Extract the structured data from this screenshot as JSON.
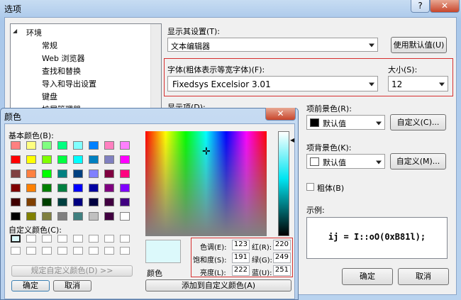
{
  "window": {
    "title": "选项",
    "help": "?",
    "close": "✕"
  },
  "tree": {
    "root": "环境",
    "expander": "◢",
    "items": [
      "常规",
      "Web 浏览器",
      "查找和替换",
      "导入和导出设置",
      "键盘",
      "扩展管理器"
    ]
  },
  "display_settings": {
    "label": "显示其设置(T):",
    "value": "文本编辑器",
    "use_default": "使用默认值(U)"
  },
  "font": {
    "label": "字体(粗体表示等宽字体)(F):",
    "value": "Fixedsys Excelsior 3.01",
    "size_label": "大小(S):",
    "size_value": "12"
  },
  "display_items": {
    "label": "显示项(D):"
  },
  "foreground": {
    "label": "项前景色(R):",
    "value": "默认值",
    "color": "#000000",
    "custom": "自定义(C)..."
  },
  "background": {
    "label": "项背景色(K):",
    "value": "默认值",
    "color": "#ffffff",
    "custom": "自定义(M)..."
  },
  "bold": {
    "label": "粗体(B)"
  },
  "sample": {
    "label": "示例:",
    "text": "ij = I::oO(0xB81l);"
  },
  "ok": "确定",
  "cancel": "取消",
  "color_dialog": {
    "title": "颜色",
    "close": "✕",
    "basic_label": "基本颜色(B):",
    "basic_colors": [
      "#ff8080",
      "#ffff80",
      "#80ff80",
      "#00ff80",
      "#80ffff",
      "#0080ff",
      "#ff80c0",
      "#ff80ff",
      "#ff0000",
      "#ffff00",
      "#80ff00",
      "#00ff40",
      "#00ffff",
      "#0080c0",
      "#8080c0",
      "#ff00ff",
      "#804040",
      "#ff8040",
      "#00ff00",
      "#008080",
      "#004080",
      "#8080ff",
      "#800040",
      "#ff0080",
      "#800000",
      "#ff8000",
      "#008000",
      "#008040",
      "#0000ff",
      "#0000a0",
      "#800080",
      "#8000ff",
      "#400000",
      "#804000",
      "#004000",
      "#004040",
      "#000080",
      "#000040",
      "#400040",
      "#400080",
      "#000000",
      "#808000",
      "#808040",
      "#808080",
      "#408080",
      "#c0c0c0",
      "#400040",
      "#ffffff"
    ],
    "custom_label": "自定义颜色(C):",
    "define_btn": "规定自定义颜色(D) >>",
    "ok": "确定",
    "cancel": "取消",
    "color_label": "颜色",
    "preview_color": "#dcf9fb",
    "hue_label": "色调(E):",
    "hue": "123",
    "sat_label": "饱和度(S):",
    "sat": "191",
    "lum_label": "亮度(L):",
    "lum": "222",
    "red_label": "红(R):",
    "red": "220",
    "green_label": "绿(G):",
    "green": "249",
    "blue_label": "蓝(U):",
    "blue": "251",
    "add_btn": "添加到自定义颜色(A)",
    "slider_arrow": "◀",
    "crosshair": "✛"
  }
}
